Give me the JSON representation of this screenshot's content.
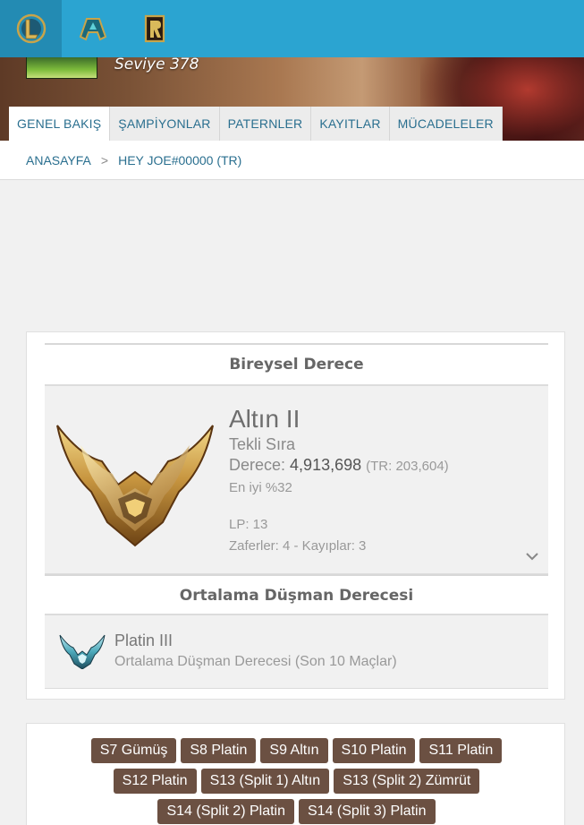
{
  "topnav": {
    "games": [
      {
        "name": "League of Legends",
        "icon": "lol-logo-icon",
        "active": true
      },
      {
        "name": "Teamfight Tactics",
        "icon": "tft-logo-icon",
        "active": false
      },
      {
        "name": "Legends of Runeterra",
        "icon": "runeterra-logo-icon",
        "active": false
      }
    ],
    "accent": "#2ba4d1"
  },
  "hero": {
    "level": "Seviye 378"
  },
  "tabs": [
    {
      "label": "GENEL BAKIŞ",
      "active": true
    },
    {
      "label": "ŞAMPİYONLAR",
      "active": false
    },
    {
      "label": "PATERNLER",
      "active": false
    },
    {
      "label": "KAYITLAR",
      "active": false
    },
    {
      "label": "MÜCADELELER",
      "active": false
    }
  ],
  "breadcrumb": {
    "home": "ANASAYFA",
    "separator": ">",
    "current": "HEY JOE#00000 (TR)"
  },
  "ranked": {
    "title": "Bireysel Derece",
    "tier": "Altın II",
    "queue": "Tekli Sıra",
    "rank_label": "Derece:",
    "rank_value": "4,913,698",
    "rank_tr": "(TR: 203,604)",
    "top_percent": "En iyi %32",
    "lp": "LP: 13",
    "wins_losses": "Zaferler: 4 - Kayıplar: 3",
    "emblem_icon": "gold-rank-emblem-icon"
  },
  "enemy": {
    "title": "Ortalama Düşman Derecesi",
    "tier": "Platin III",
    "description": "Ortalama Düşman Derecesi (Son 10 Maçlar)",
    "emblem_icon": "platinum-rank-emblem-icon"
  },
  "seasons": {
    "badge_color": "#6b5042",
    "rows": [
      [
        "S7 Gümüş",
        "S8 Platin",
        "S9 Altın",
        "S10 Platin",
        "S11 Platin"
      ],
      [
        "S12 Platin",
        "S13 (Split 1) Altın",
        "S13 (Split 2) Zümrüt"
      ],
      [
        "S14 (Split 2) Platin",
        "S14 (Split 3) Platin"
      ]
    ]
  }
}
